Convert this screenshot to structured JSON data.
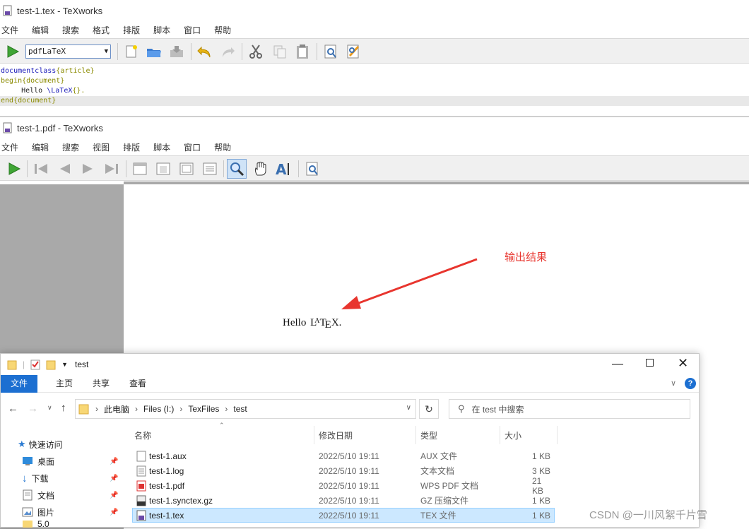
{
  "editor": {
    "title": "test-1.tex - TeXworks",
    "menu": [
      "文件",
      "编辑",
      "搜索",
      "格式",
      "排版",
      "脚本",
      "窗口",
      "帮助"
    ],
    "engine": "pdfLaTeX",
    "toolbar_icons": [
      "new-file-icon",
      "open-folder-icon",
      "save-icon",
      "undo-icon",
      "redo-icon",
      "cut-icon",
      "copy-icon",
      "paste-icon",
      "find-icon",
      "replace-icon"
    ],
    "code": {
      "line1_cmd": "\\documentclass",
      "line1_arg": "{article}",
      "line2_cmd": "\\begin",
      "line2_arg": "{document}",
      "line3_text": "     Hello ",
      "line3_cmd": "\\LaTeX",
      "line3_arg": "{}.",
      "line4_cmd": "\\end",
      "line4_arg": "{document}"
    }
  },
  "pdf": {
    "title": "test-1.pdf - TeXworks",
    "menu": [
      "文件",
      "编辑",
      "搜索",
      "视图",
      "排版",
      "脚本",
      "窗口",
      "帮助"
    ],
    "output_hello": "Hello",
    "annotation": "输出结果",
    "accent_red": "#e8352e"
  },
  "explorer": {
    "title": "test",
    "ribbon_tabs": [
      "文件",
      "主页",
      "共享",
      "查看"
    ],
    "breadcrumb": [
      "此电脑",
      "Files (I:)",
      "TexFiles",
      "test"
    ],
    "search_placeholder": "在 test 中搜索",
    "nav": [
      {
        "label": "快速访问"
      },
      {
        "label": "桌面"
      },
      {
        "label": "下载"
      },
      {
        "label": "文档"
      },
      {
        "label": "图片"
      },
      {
        "label": "5.0"
      }
    ],
    "columns": [
      "名称",
      "修改日期",
      "类型",
      "大小"
    ],
    "files": [
      {
        "name": "test-1.aux",
        "date": "2022/5/10 19:11",
        "type": "AUX 文件",
        "size": "1 KB"
      },
      {
        "name": "test-1.log",
        "date": "2022/5/10 19:11",
        "type": "文本文档",
        "size": "3 KB"
      },
      {
        "name": "test-1.pdf",
        "date": "2022/5/10 19:11",
        "type": "WPS PDF 文档",
        "size": "21 KB"
      },
      {
        "name": "test-1.synctex.gz",
        "date": "2022/5/10 19:11",
        "type": "GZ 压缩文件",
        "size": "1 KB"
      },
      {
        "name": "test-1.tex",
        "date": "2022/5/10 19:11",
        "type": "TEX 文件",
        "size": "1 KB"
      }
    ],
    "selected_file": "test-1.tex",
    "selection_color": "#cce8ff"
  },
  "watermark": "CSDN @一川风絮千片雪"
}
